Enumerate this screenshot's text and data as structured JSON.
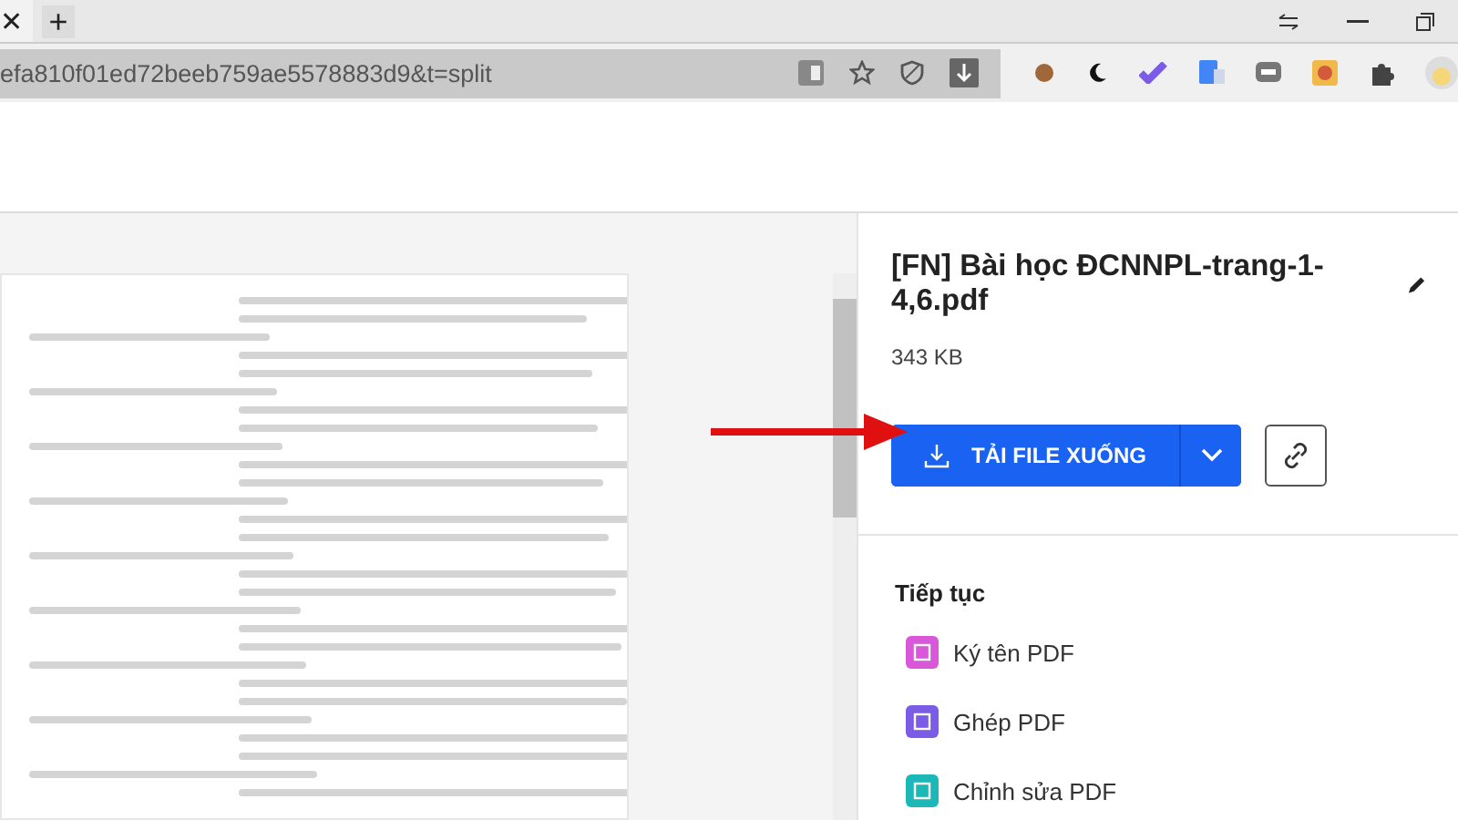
{
  "browser": {
    "tab_close": "✕",
    "new_tab": "+",
    "url": "efa810f01ed72beeb759ae5578883d9&t=split"
  },
  "file": {
    "name": "[FN] Bài học ĐCNNPL-trang-1-4,6.pdf",
    "size": "343 KB",
    "download_label": "TẢI FILE XUỐNG"
  },
  "continue": {
    "heading": "Tiếp tục",
    "items": [
      {
        "label": "Ký tên PDF",
        "color": "#d957d9"
      },
      {
        "label": "Ghép PDF",
        "color": "#7b5ce6"
      },
      {
        "label": "Chỉnh sửa PDF",
        "color": "#1cb8b8"
      }
    ]
  }
}
